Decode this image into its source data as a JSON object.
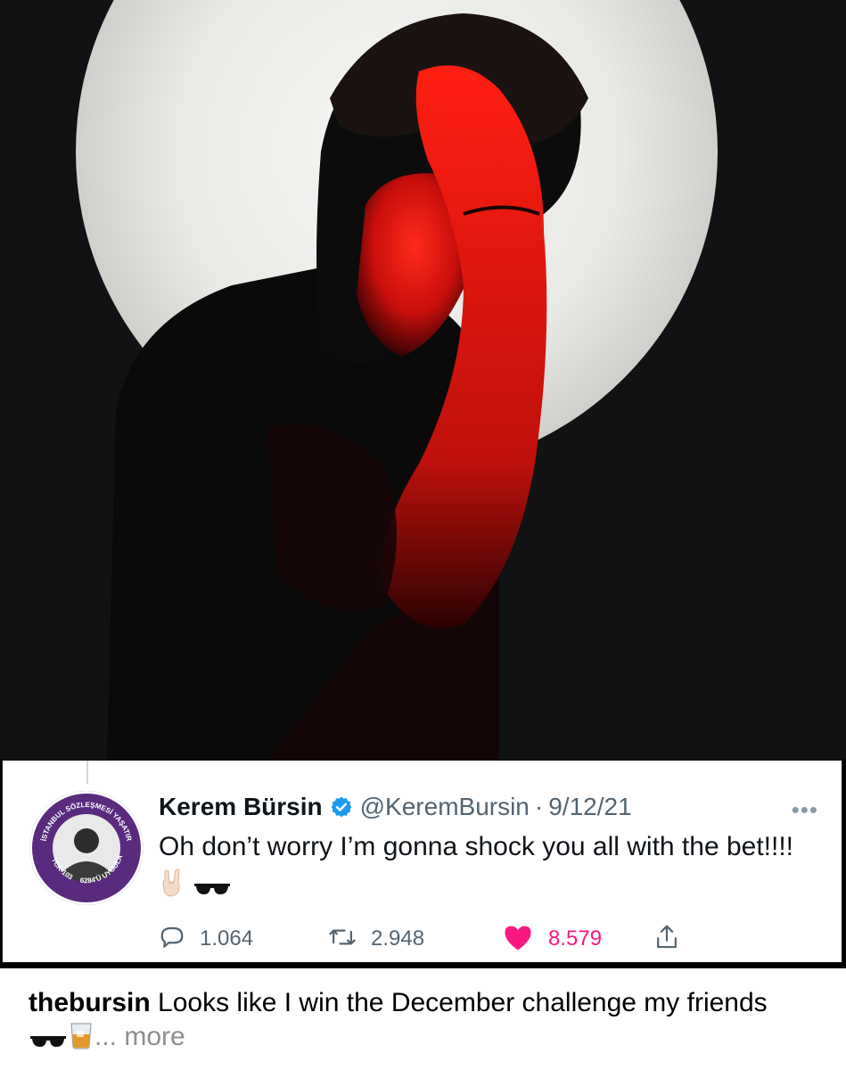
{
  "tweet": {
    "display_name": "Kerem Bürsin",
    "handle": "@KeremBursin",
    "separator": "·",
    "date": "9/12/21",
    "text": "Oh don’t worry I’m gonna shock you all with the bet!!!!",
    "emoji_icons": [
      "rock-on-hand-icon",
      "sunglasses-icon"
    ],
    "avatar_badge_text": [
      "İSTANBUL SÖZLEŞMESİ YAŞATIR",
      "TCK-103",
      "6284'Ü UYGULA"
    ],
    "actions": {
      "replies": "1.064",
      "retweets": "2.948",
      "likes": "8.579"
    },
    "colors": {
      "like": "#f91880",
      "verified": "#1d9bf0",
      "muted": "#536471",
      "avatar_ring": "#5a2a7e"
    }
  },
  "caption": {
    "username": "thebursin",
    "text_line": "Looks like I win the December challenge  my friends",
    "emoji_icons": [
      "sunglasses-icon",
      "whisky-glass-icon"
    ],
    "more_label": "... more"
  }
}
